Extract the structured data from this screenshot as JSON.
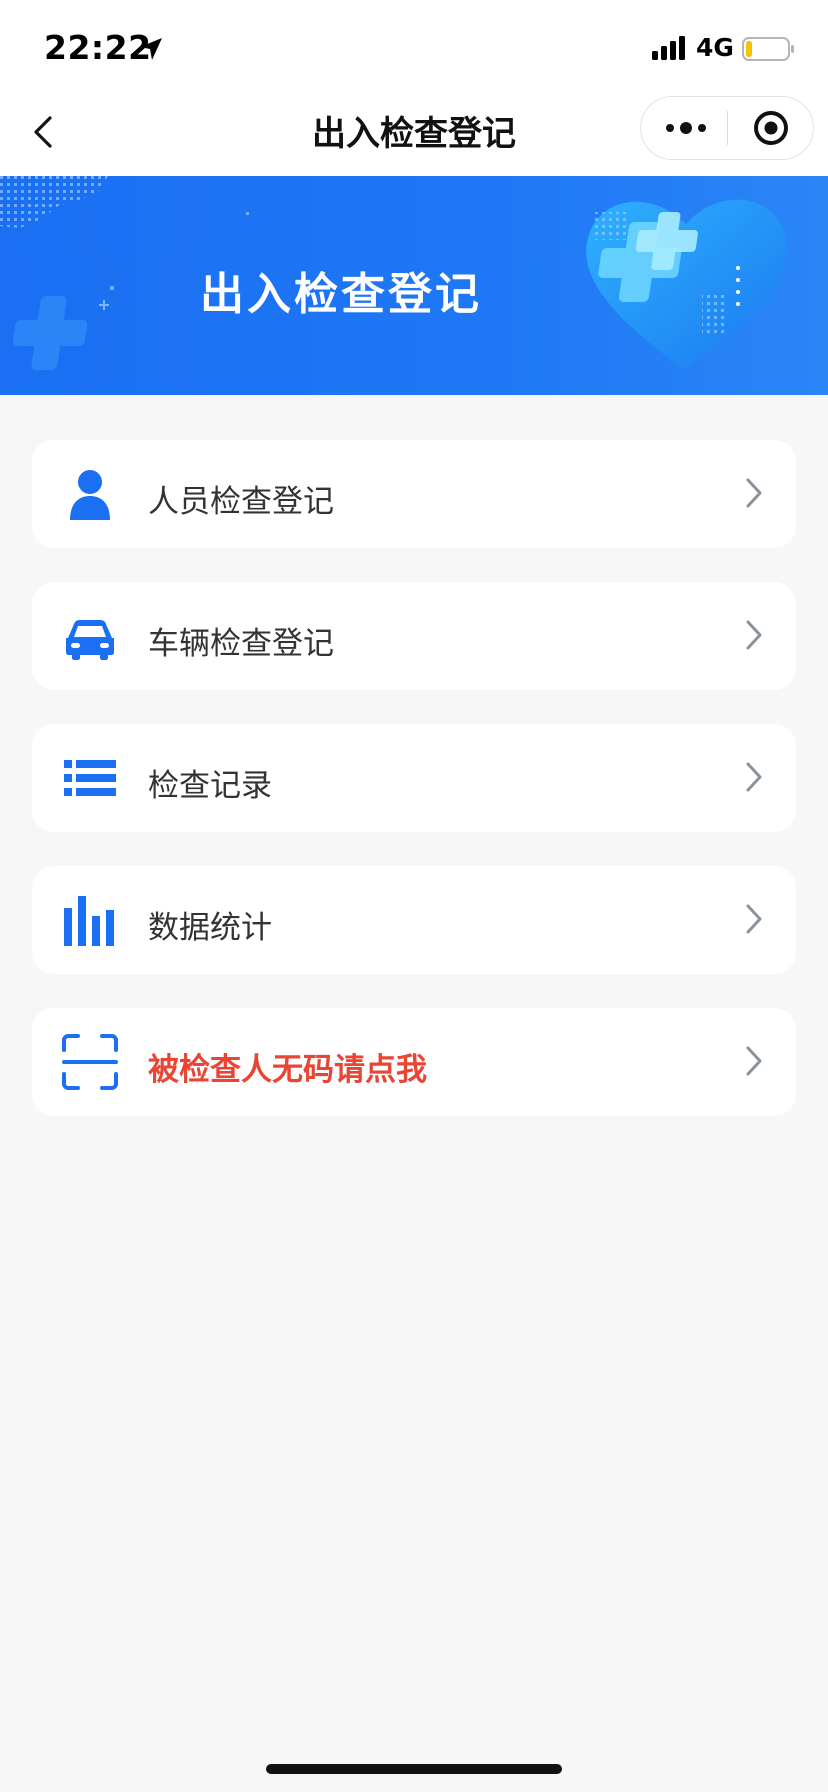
{
  "status_bar": {
    "time": "22:22",
    "network": "4G"
  },
  "nav": {
    "title": "出入检查登记"
  },
  "banner": {
    "title": "出入检查登记"
  },
  "menu": [
    {
      "id": "person",
      "label": "人员检查登记",
      "icon": "person-icon"
    },
    {
      "id": "vehicle",
      "label": "车辆检查登记",
      "icon": "car-icon"
    },
    {
      "id": "records",
      "label": "检查记录",
      "icon": "list-icon"
    },
    {
      "id": "stats",
      "label": "数据统计",
      "icon": "bar-chart-icon"
    },
    {
      "id": "nocode",
      "label": "被检查人无码请点我",
      "icon": "scan-icon",
      "warning": true
    }
  ],
  "colors": {
    "accent": "#1a6ff2",
    "warning": "#e94535",
    "background": "#f7f7f7",
    "text": "#333333"
  }
}
